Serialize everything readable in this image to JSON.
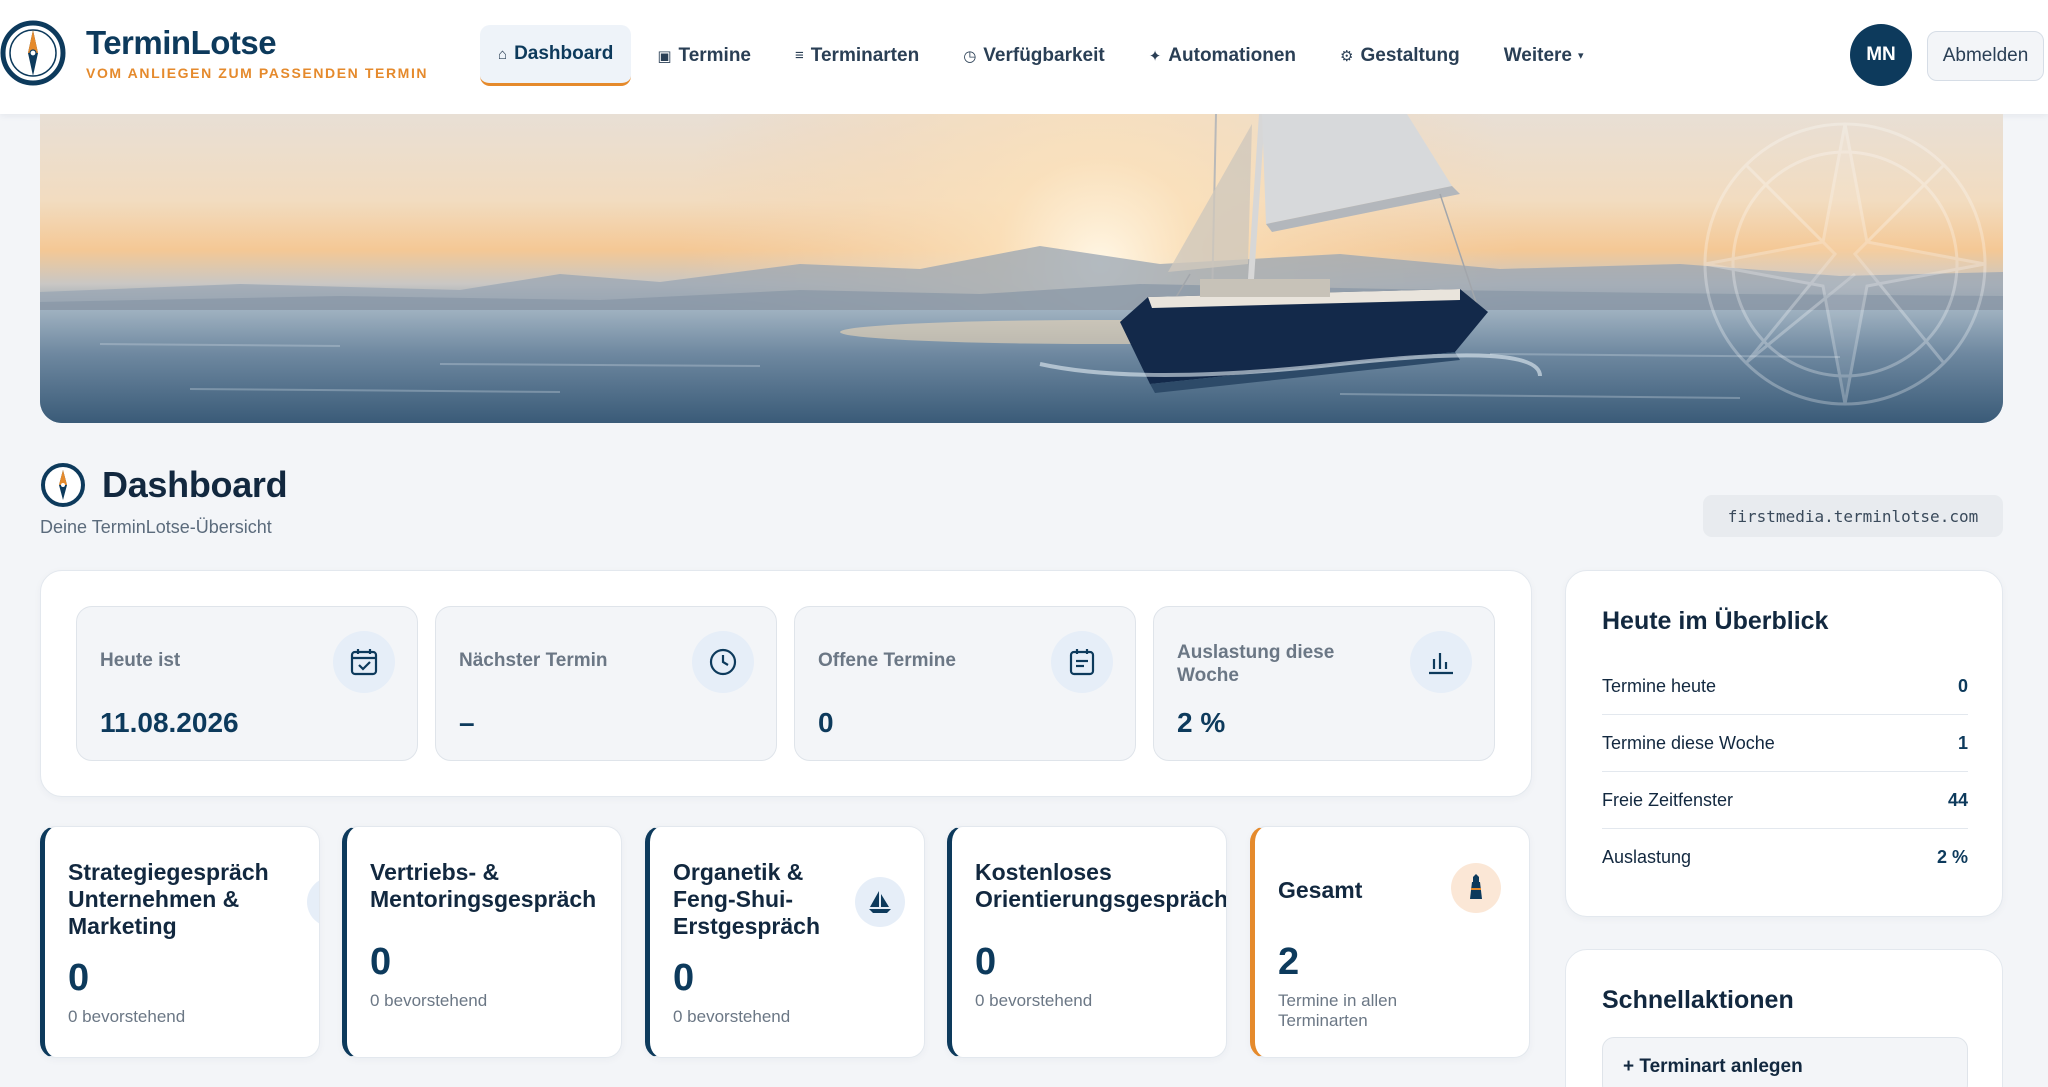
{
  "brand": {
    "name": "TerminLotse",
    "tagline": "VOM ANLIEGEN ZUM PASSENDEN TERMIN"
  },
  "nav": [
    {
      "icon": "⌂",
      "label": "Dashboard",
      "active": true
    },
    {
      "icon": "▣",
      "label": "Termine"
    },
    {
      "icon": "≡",
      "label": "Terminarten"
    },
    {
      "icon": "◷",
      "label": "Verfügbarkeit"
    },
    {
      "icon": "✦",
      "label": "Automationen"
    },
    {
      "icon": "⚙",
      "label": "Gestaltung"
    },
    {
      "icon": "",
      "label": "Weitere",
      "caret": "▾"
    }
  ],
  "user": {
    "initials": "MN",
    "logout_label": "Abmelden"
  },
  "page": {
    "title": "Dashboard",
    "subtitle": "Deine TerminLotse-Übersicht",
    "domain": "firstmedia.terminlotse.com"
  },
  "stats": [
    {
      "label": "Heute ist",
      "value": "11.08.2026",
      "icon": "calendar-check-icon"
    },
    {
      "label": "Nächster Termin",
      "value": "–",
      "icon": "clock-icon"
    },
    {
      "label": "Offene Termine",
      "value": "0",
      "icon": "calendar-list-icon"
    },
    {
      "label": "Auslastung diese Woche",
      "value": "2 %",
      "icon": "bar-chart-icon"
    }
  ],
  "types": [
    {
      "title": "Strategiegespräch Unternehmen & Marketing",
      "count": "0",
      "sub": "0 bevorstehend",
      "icon": "compass-icon"
    },
    {
      "title": "Vertriebs- & Mentoringsgespräch",
      "count": "0",
      "sub": "0 bevorstehend"
    },
    {
      "title": "Organetik & Feng-Shui-Erstgespräch",
      "count": "0",
      "sub": "0 bevorstehend",
      "icon": "sailboat-icon"
    },
    {
      "title": "Kostenloses Orientierungsgespräch",
      "count": "0",
      "sub": "0 bevorstehend"
    },
    {
      "title": "Gesamt",
      "count": "2",
      "sub": "Termine in allen Terminarten",
      "icon": "lighthouse-icon"
    }
  ],
  "overview": {
    "title": "Heute im Überblick",
    "rows": [
      {
        "label": "Termine heute",
        "value": "0"
      },
      {
        "label": "Termine diese Woche",
        "value": "1"
      },
      {
        "label": "Freie Zeitfenster",
        "value": "44"
      },
      {
        "label": "Auslastung",
        "value": "2 %"
      }
    ]
  },
  "quick": {
    "title": "Schnellaktionen",
    "button": "+ Terminart anlegen"
  },
  "colors": {
    "navy": "#0d3a5c",
    "accent": "#e58a2c",
    "background": "#f3f5f8"
  }
}
